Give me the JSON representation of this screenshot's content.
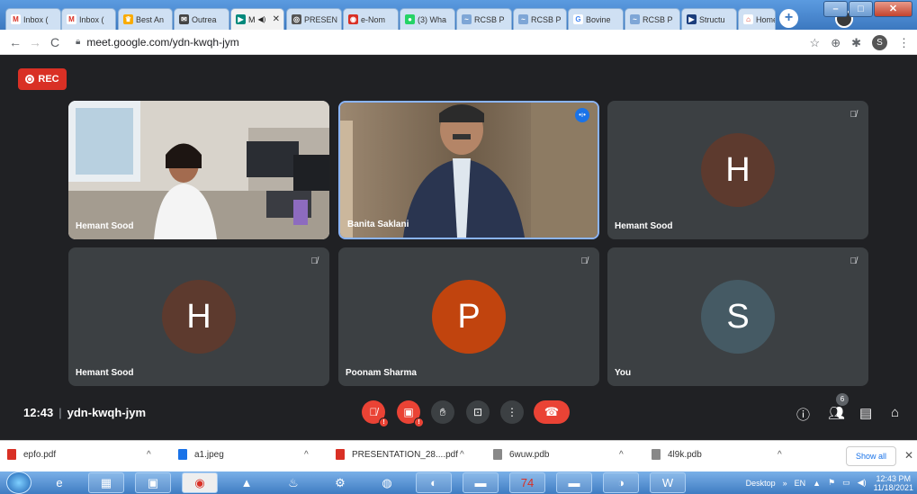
{
  "browser": {
    "tabs": [
      {
        "label": "Inbox (",
        "icon": "gmail-icon",
        "color": "#d93025",
        "icon_glyph": "M"
      },
      {
        "label": "Inbox (",
        "icon": "gmail-icon",
        "color": "#d93025",
        "icon_glyph": "M"
      },
      {
        "label": "Best An",
        "icon": "trophy-icon",
        "color": "#f9ab00",
        "icon_glyph": "♛"
      },
      {
        "label": "Outrea",
        "icon": "mail-icon",
        "color": "#444444",
        "icon_glyph": "✉"
      },
      {
        "label": "M",
        "icon": "meet-icon",
        "color": "#00897b",
        "icon_glyph": "▶",
        "active": true
      },
      {
        "label": "PRESEN",
        "icon": "globe-icon",
        "color": "#555555",
        "icon_glyph": "◎"
      },
      {
        "label": "e-Nom",
        "icon": "enom-icon",
        "color": "#d93025",
        "icon_glyph": "◉"
      },
      {
        "label": "(3) Wha",
        "icon": "whatsapp-icon",
        "color": "#25d366",
        "icon_glyph": "●"
      },
      {
        "label": "RCSB P",
        "icon": "rcsb-icon",
        "color": "#7ea6d6",
        "icon_glyph": "~"
      },
      {
        "label": "RCSB P",
        "icon": "rcsb-icon",
        "color": "#7ea6d6",
        "icon_glyph": "~"
      },
      {
        "label": "Bovine",
        "icon": "google-icon",
        "color": "#4285f4",
        "icon_glyph": "G"
      },
      {
        "label": "RCSB P",
        "icon": "rcsb-icon",
        "color": "#7ea6d6",
        "icon_glyph": "~"
      },
      {
        "label": "Structu",
        "icon": "structure-icon",
        "color": "#1a3d7c",
        "icon_glyph": "▶"
      },
      {
        "label": "Home",
        "icon": "home-icon",
        "color": "#d93025",
        "icon_glyph": "⌂"
      }
    ],
    "url": "meet.google.com/ydn-kwqh-jym",
    "profile_initial": "S"
  },
  "meet": {
    "rec_label": "REC",
    "meeting_time": "12:43",
    "meeting_code": "ydn-kwqh-jym",
    "people_count": "6",
    "tiles": [
      {
        "name": "Hemant Sood",
        "type": "video",
        "bg": "#c9c4bd"
      },
      {
        "name": "Banita Saklani",
        "type": "video",
        "bg": "#7c6a55",
        "speaking": true
      },
      {
        "name": "Hemant Sood",
        "type": "avatar",
        "initial": "H",
        "color": "#5d3a2e",
        "muted": true
      },
      {
        "name": "Hemant Sood",
        "type": "avatar",
        "initial": "H",
        "color": "#5d3a2e",
        "muted": true
      },
      {
        "name": "Poonam Sharma",
        "type": "avatar",
        "initial": "P",
        "color": "#c1440e",
        "muted": true
      },
      {
        "name": "You",
        "type": "avatar",
        "initial": "S",
        "color": "#455a64",
        "muted": true
      }
    ]
  },
  "downloads": {
    "items": [
      {
        "label": "epfo.pdf",
        "color": "#d93025"
      },
      {
        "label": "a1.jpeg",
        "color": "#1a73e8"
      },
      {
        "label": "PRESENTATION_28....pdf",
        "color": "#d93025"
      },
      {
        "label": "6wuw.pdb",
        "color": "#888888"
      },
      {
        "label": "4l9k.pdb",
        "color": "#888888"
      }
    ],
    "show_all": "Show all"
  },
  "taskbar": {
    "desktop_label": "Desktop",
    "lang": "EN",
    "time": "12:43 PM",
    "date": "11/18/2021"
  }
}
